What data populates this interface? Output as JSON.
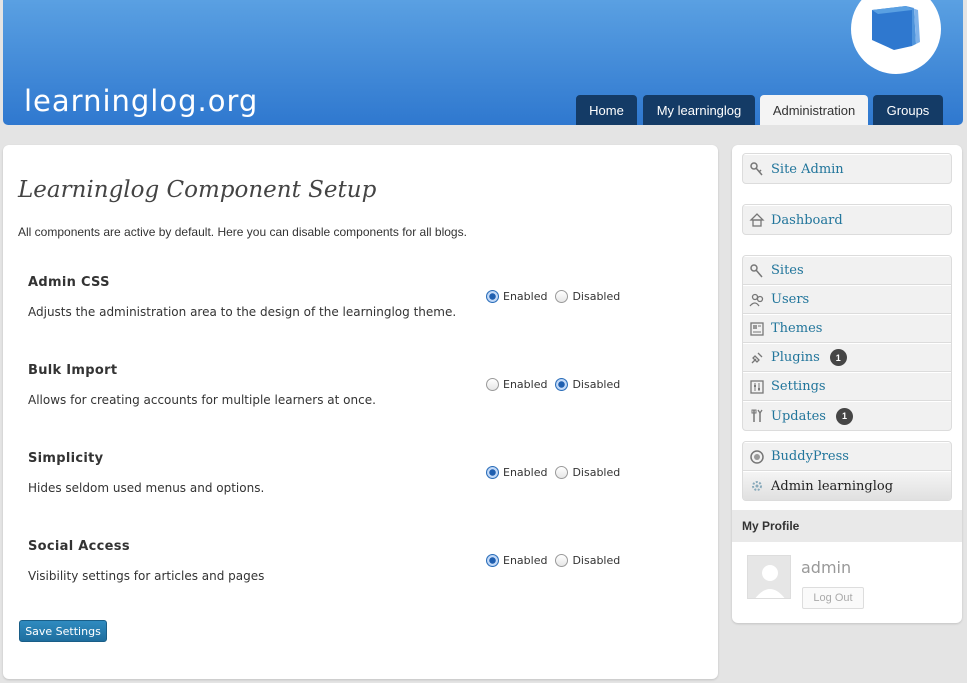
{
  "header": {
    "logo_text": "learninglog.org",
    "nav": [
      {
        "label": "Home",
        "active": false
      },
      {
        "label": "My learninglog",
        "active": false
      },
      {
        "label": "Administration",
        "active": true
      },
      {
        "label": "Groups",
        "active": false
      }
    ]
  },
  "main": {
    "title": "Learninglog Component Setup",
    "intro": "All components are active by default. Here you can disable components for all blogs.",
    "enabled_label": "Enabled",
    "disabled_label": "Disabled",
    "components": [
      {
        "title": "Admin CSS",
        "description": "Adjusts the administration area to the design of the learninglog theme.",
        "state": "enabled"
      },
      {
        "title": "Bulk Import",
        "description": "Allows for creating accounts for multiple learners at once.",
        "state": "disabled"
      },
      {
        "title": "Simplicity",
        "description": "Hides seldom used menus and options.",
        "state": "enabled"
      },
      {
        "title": "Social Access",
        "description": "Visibility settings for articles and pages",
        "state": "enabled"
      }
    ],
    "save_label": "Save Settings"
  },
  "sidebar": {
    "site_admin": "Site Admin",
    "dashboard": "Dashboard",
    "network": [
      {
        "label": "Sites",
        "icon": "sites-icon"
      },
      {
        "label": "Users",
        "icon": "users-icon"
      },
      {
        "label": "Themes",
        "icon": "themes-icon"
      },
      {
        "label": "Plugins",
        "icon": "plugins-icon",
        "badge": "1"
      },
      {
        "label": "Settings",
        "icon": "settings-icon"
      },
      {
        "label": "Updates",
        "icon": "updates-icon",
        "badge": "1"
      }
    ],
    "buddypress": "BuddyPress",
    "admin_learninglog": "Admin learninglog",
    "profile_heading": "My Profile",
    "profile_name": "admin",
    "logout_label": "Log Out"
  },
  "colors": {
    "header_top": "#5aa0e2",
    "header_bottom": "#2f78cf",
    "nav_tab": "#143b66",
    "link": "#21759b",
    "save_button": "#2f8bc0"
  }
}
